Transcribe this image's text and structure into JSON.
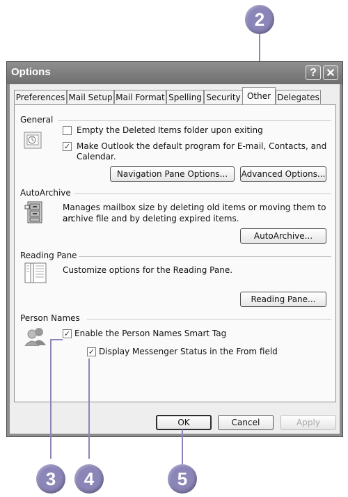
{
  "window": {
    "title": "Options",
    "help_icon": "?",
    "close_icon": "✕"
  },
  "tabs": [
    {
      "label": "Preferences"
    },
    {
      "label": "Mail Setup"
    },
    {
      "label": "Mail Format"
    },
    {
      "label": "Spelling"
    },
    {
      "label": "Security"
    },
    {
      "label": "Other"
    },
    {
      "label": "Delegates"
    }
  ],
  "active_tab": "Other",
  "general": {
    "heading": "General",
    "empty_deleted_label": "Empty the Deleted Items folder upon exiting",
    "empty_deleted_checked": false,
    "default_program_line1": "Make Outlook the default program for E-mail, Contacts, and",
    "default_program_line2": "Calendar.",
    "default_program_checked": true,
    "nav_pane_button": "Navigation Pane Options...",
    "advanced_button": "Advanced Options..."
  },
  "autoarchive": {
    "heading": "AutoArchive",
    "desc_line1": "Manages mailbox size by deleting old items or moving them to an",
    "desc_line2": "archive file and by deleting expired items.",
    "button": "AutoArchive..."
  },
  "reading_pane": {
    "heading": "Reading Pane",
    "desc": "Customize options for the Reading Pane.",
    "button": "Reading Pane..."
  },
  "person_names": {
    "heading": "Person Names",
    "smart_tag_label": "Enable the Person Names Smart Tag",
    "smart_tag_checked": true,
    "messenger_label": "Display Messenger Status in the From field",
    "messenger_checked": true
  },
  "footer": {
    "ok": "OK",
    "cancel": "Cancel",
    "apply": "Apply"
  },
  "callouts": {
    "c2": "2",
    "c3": "3",
    "c4": "4",
    "c5": "5"
  },
  "colors": {
    "callout": "#8b86b8"
  }
}
